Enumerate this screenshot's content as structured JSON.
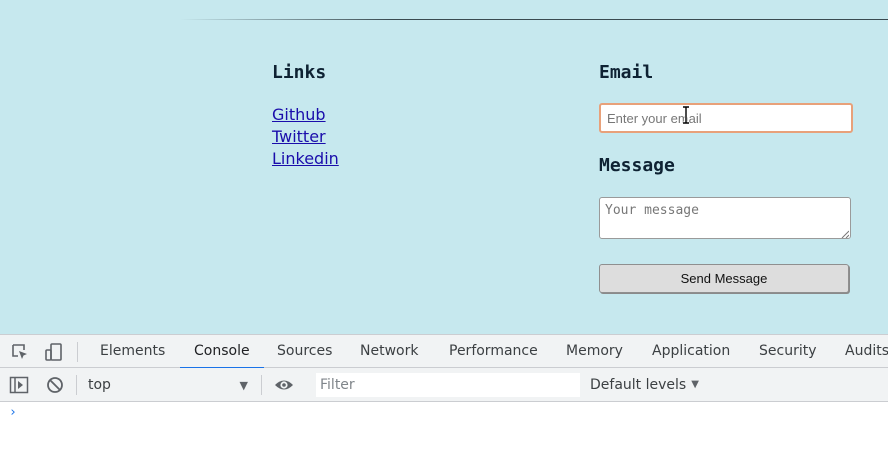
{
  "page": {
    "links": {
      "heading": "Links",
      "items": [
        {
          "label": "Github"
        },
        {
          "label": "Twitter"
        },
        {
          "label": "Linkedin"
        }
      ]
    },
    "form": {
      "email_heading": "Email",
      "email_placeholder": "Enter your email",
      "email_value": "",
      "message_heading": "Message",
      "message_placeholder": "Your message",
      "message_value": "",
      "send_label": "Send Message"
    }
  },
  "devtools": {
    "tabs": [
      {
        "label": "Elements",
        "active": false
      },
      {
        "label": "Console",
        "active": true
      },
      {
        "label": "Sources",
        "active": false
      },
      {
        "label": "Network",
        "active": false
      },
      {
        "label": "Performance",
        "active": false
      },
      {
        "label": "Memory",
        "active": false
      },
      {
        "label": "Application",
        "active": false
      },
      {
        "label": "Security",
        "active": false
      },
      {
        "label": "Audits",
        "active": false
      }
    ],
    "toolbar": {
      "context": "top",
      "filter_placeholder": "Filter",
      "levels": "Default levels"
    },
    "prompt_symbol": "›"
  },
  "colors": {
    "page_background": "#c6e8ee",
    "link": "#1a0dab",
    "focus_border": "#e8a17a",
    "active_tab_indicator": "#1a73e8"
  },
  "icons": [
    "inspect-element-icon",
    "device-toggle-icon",
    "sidebar-toggle-icon",
    "clear-console-icon",
    "eye-icon",
    "text-cursor-icon"
  ]
}
